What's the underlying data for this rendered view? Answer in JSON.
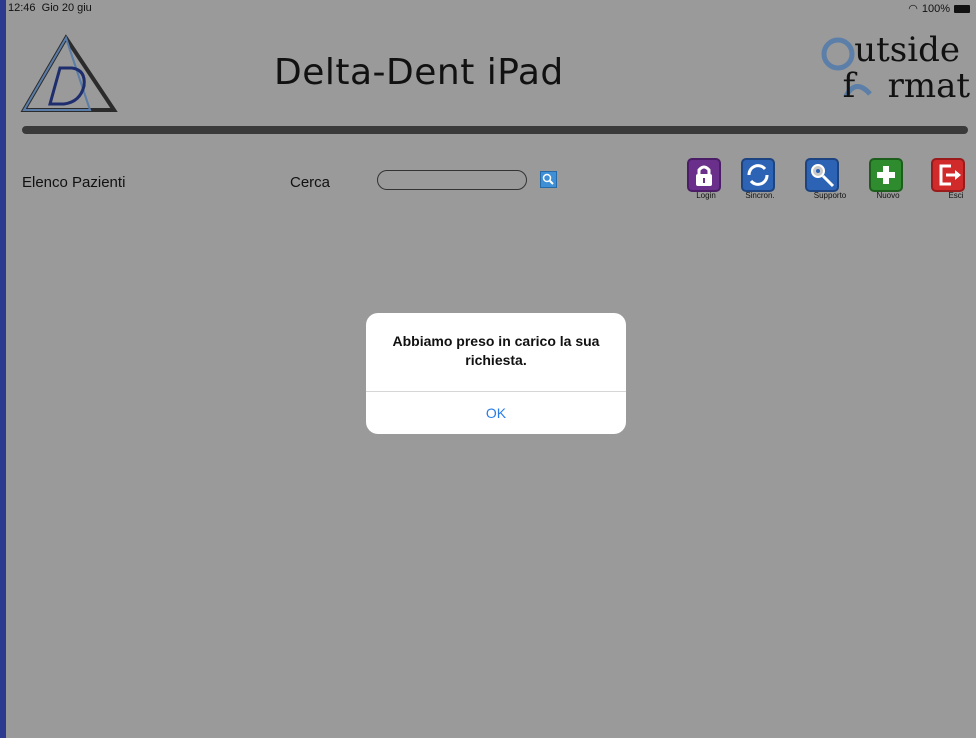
{
  "status_bar": {
    "time": "12:46",
    "date": "Gio 20 giu",
    "battery": "100%"
  },
  "header": {
    "title": "Delta-Dent iPad",
    "brand_logo_text": "Outside Format"
  },
  "patients": {
    "list_label": "Elenco Pazienti",
    "search_label": "Cerca",
    "search_value": ""
  },
  "toolbar": {
    "buttons": [
      {
        "label": "Login",
        "icon": "lock-icon",
        "color": "#6a2f8a"
      },
      {
        "label": "Sincron.",
        "icon": "sync-icon",
        "color": "#2d63b4"
      },
      {
        "label": "Supporto",
        "icon": "gear-wrench-icon",
        "color": "#2d63b4"
      },
      {
        "label": "Nuovo",
        "icon": "plus-icon",
        "color": "#2e8b2e"
      },
      {
        "label": "Esci",
        "icon": "exit-icon",
        "color": "#d12a2a"
      }
    ]
  },
  "dialog": {
    "message": "Abbiamo preso in carico la sua richiesta.",
    "ok_label": "OK"
  },
  "colors": {
    "overlay_background": "#9a9a9a",
    "accent": "#2a7ce8"
  }
}
